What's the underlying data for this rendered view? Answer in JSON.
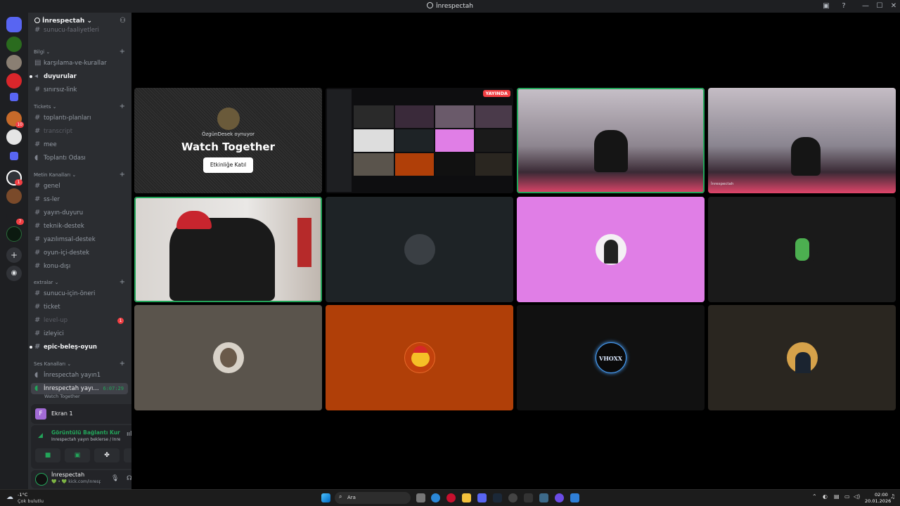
{
  "window": {
    "title": "İnrespectah"
  },
  "server": {
    "name": "İnrespectah",
    "scroll_top_label": "sunucu-faaliyetleri"
  },
  "categories": {
    "bilgi": "Bilgi",
    "tickets": "Tickets",
    "metin": "Metin Kanalları",
    "extralar": "extralar",
    "ses": "Ses Kanalları"
  },
  "channels": {
    "karsilama": "karşılama-ve-kurallar",
    "duyurular": "duyurular",
    "sinirsiz": "sınırsız-link",
    "toplanti_planlari": "toplantı-planları",
    "transcript": "transcript",
    "mee": "mee",
    "toplanti_odasi": "Toplantı Odası",
    "genel": "genel",
    "ss": "ss-ler",
    "yayin_duyuru": "yayın-duyuru",
    "teknik": "teknik-destek",
    "yazilimsal": "yazılımsal-destek",
    "oyun_ici": "oyun-içi-destek",
    "konu_disi": "konu-dışı",
    "sunucu_icin": "sunucu-için-öneri",
    "ticket": "ticket",
    "level_up": "level-up",
    "level_up_badge": "1",
    "izleyici": "izleyici",
    "epic": "epic-beleş-oyun",
    "voice1": "İnrespectah yayın1",
    "voice2": "İnrespectah yayı...",
    "voice2_timer": "6:07:29",
    "voice2_activity": "Watch Together"
  },
  "screen_panel": {
    "label": "Ekran 1",
    "avatar_letter": "F"
  },
  "voice_panel": {
    "status": "Görüntülü Bağlantı Kuruld",
    "detail": "İnrespectah yayın beklerse / İnre..."
  },
  "user_panel": {
    "name": "İnrespectah",
    "status": "💚 • 💚 kick.com/inresp..."
  },
  "server_badges": {
    "s6": "10",
    "s10": "1",
    "s12": "7"
  },
  "watch_together": {
    "playing": "ÖzgünDesek oynuyor",
    "title": "Watch Together",
    "button": "Etkinliğe Katıl"
  },
  "stream_badge": "YAYINDA",
  "tile_tags": {
    "cam2_name": "İnrespectah"
  },
  "avatar_texts": {
    "vhoxx": "VHOXX"
  },
  "taskbar": {
    "weather_temp": "-1°C",
    "weather_desc": "Çok bulutlu",
    "search": "Ara",
    "time": "02:00",
    "date": "20.01.2026"
  },
  "colors": {
    "speaking": "#23a55a",
    "live": "#f23f43",
    "pink_tile": "#e07ee6",
    "orange_tile": "#b03f08"
  }
}
